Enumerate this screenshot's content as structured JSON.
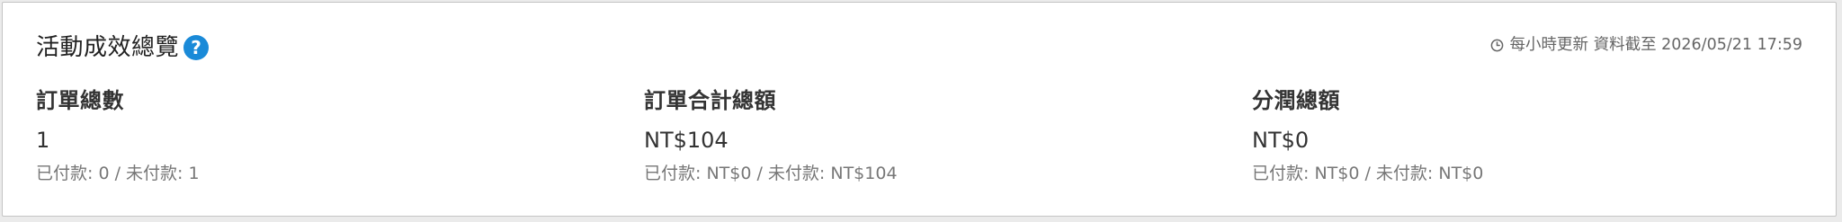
{
  "panel": {
    "title": "活動成效總覽",
    "update_info": "每小時更新 資料截至 2026/05/21 17:59"
  },
  "stats": [
    {
      "label": "訂單總數",
      "value": "1",
      "sub": "已付款: 0 / 未付款: 1"
    },
    {
      "label": "訂單合計總額",
      "value": "NT$104",
      "sub": "已付款: NT$0 / 未付款: NT$104"
    },
    {
      "label": "分潤總額",
      "value": "NT$0",
      "sub": "已付款: NT$0 / 未付款: NT$0"
    }
  ],
  "icons": {
    "help": "question-circle-icon",
    "clock": "clock-icon"
  },
  "colors": {
    "help_icon": "#1a8ad8",
    "text_primary": "#333333",
    "text_secondary": "#777777"
  }
}
